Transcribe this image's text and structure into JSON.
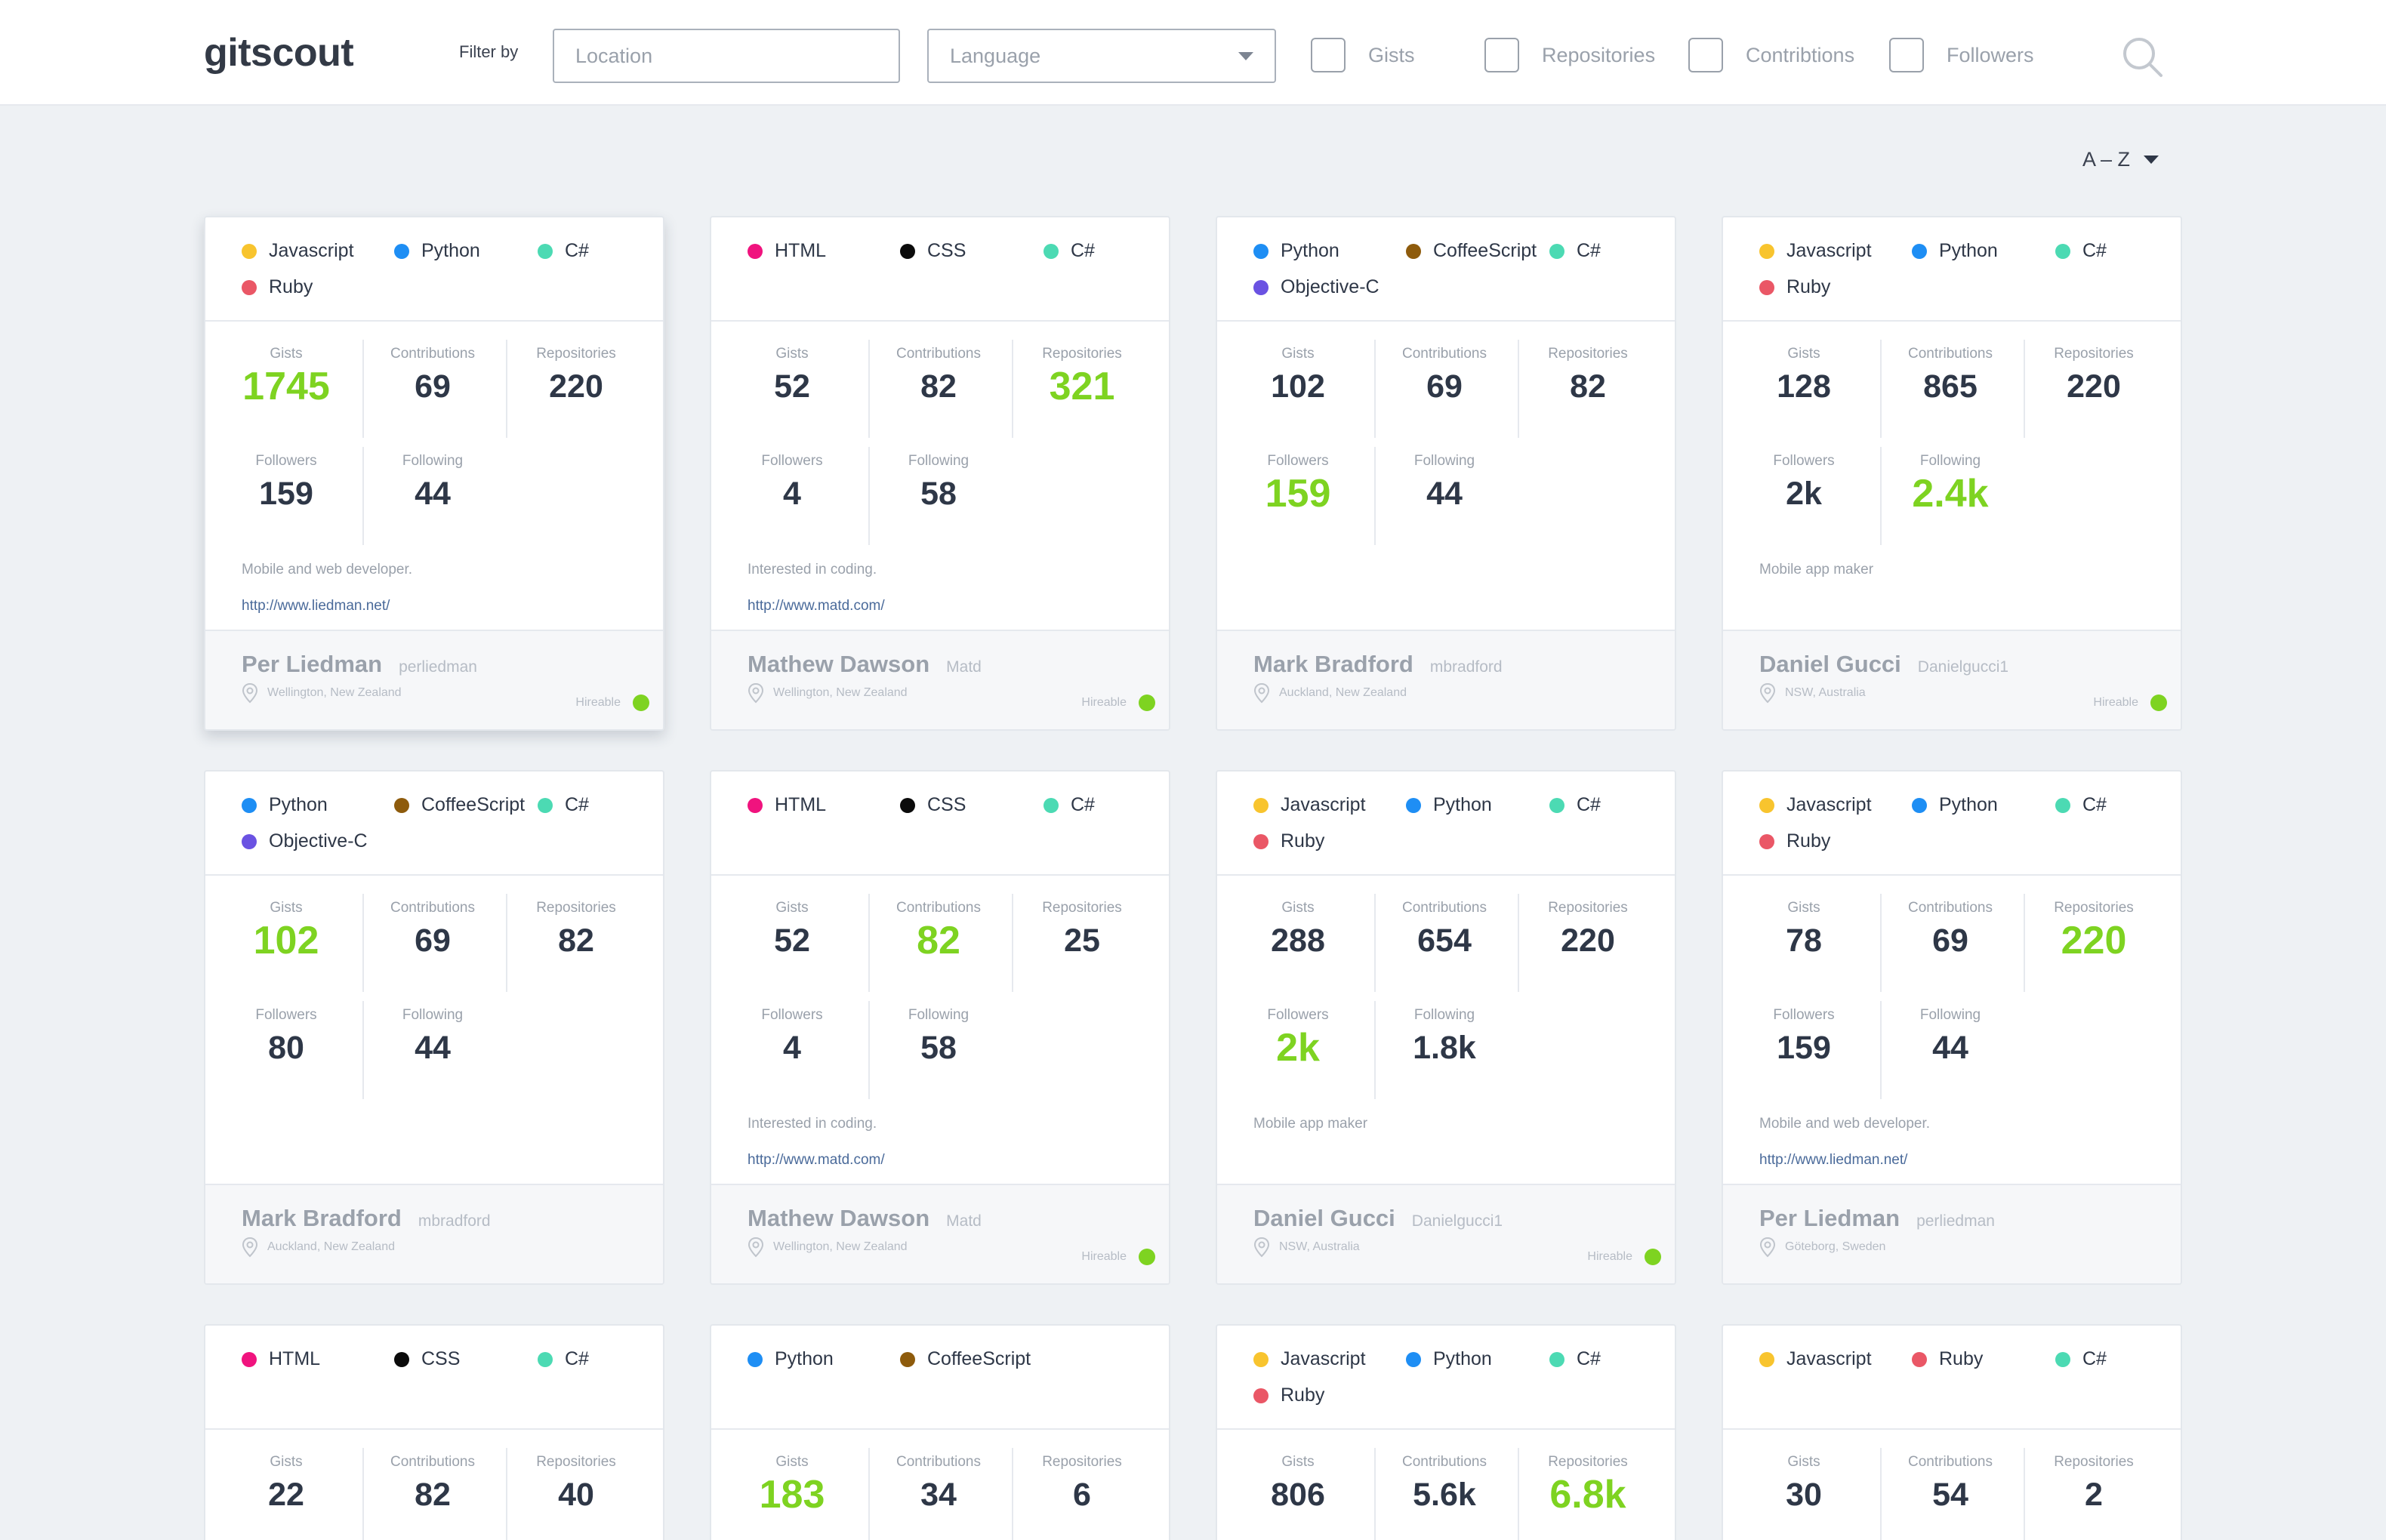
{
  "app": {
    "logo": "gitscout"
  },
  "filters": {
    "label": "Filter by",
    "location_placeholder": "Location",
    "language_placeholder": "Language",
    "checks": [
      "Gists",
      "Repositories",
      "Contribtions",
      "Followers"
    ]
  },
  "sort": {
    "label": "A – Z"
  },
  "colors": {
    "Javascript": "#f8c42e",
    "Python": "#1e8ef4",
    "C#": "#4cdab3",
    "Ruby": "#ea5766",
    "HTML": "#f0137e",
    "CSS": "#0b0b0b",
    "CoffeeScript": "#8e5b0c",
    "Objective-C": "#6a52e2",
    "highlight": "#7ed321"
  },
  "stat_labels": {
    "gists": "Gists",
    "contributions": "Contributions",
    "repositories": "Repositories",
    "followers": "Followers",
    "following": "Following"
  },
  "hireable_label": "Hireable",
  "cards": [
    {
      "langs": [
        "Javascript",
        "Python",
        "C#",
        "Ruby"
      ],
      "gists": "1745",
      "contributions": "69",
      "repositories": "220",
      "followers": "159",
      "following": "44",
      "highlight": "gists",
      "bio": "Mobile and web developer.",
      "url": "http://www.liedman.net/",
      "name": "Per Liedman",
      "username": "perliedman",
      "location": "Wellington, New Zealand",
      "hireable": true
    },
    {
      "langs": [
        "HTML",
        "CSS",
        "C#"
      ],
      "gists": "52",
      "contributions": "82",
      "repositories": "321",
      "followers": "4",
      "following": "58",
      "highlight": "repositories",
      "bio": "Interested in coding.",
      "url": "http://www.matd.com/",
      "name": "Mathew Dawson",
      "username": "Matd",
      "location": "Wellington, New Zealand",
      "hireable": true
    },
    {
      "langs": [
        "Python",
        "CoffeeScript",
        "C#",
        "Objective-C"
      ],
      "gists": "102",
      "contributions": "69",
      "repositories": "82",
      "followers": "159",
      "following": "44",
      "highlight": "followers",
      "bio": "",
      "url": "",
      "name": "Mark Bradford",
      "username": "mbradford",
      "location": "Auckland, New Zealand",
      "hireable": false
    },
    {
      "langs": [
        "Javascript",
        "Python",
        "C#",
        "Ruby"
      ],
      "gists": "128",
      "contributions": "865",
      "repositories": "220",
      "followers": "2k",
      "following": "2.4k",
      "highlight": "following",
      "bio": "Mobile app maker",
      "url": "",
      "name": "Daniel Gucci",
      "username": "Danielgucci1",
      "location": "NSW, Australia",
      "hireable": true
    },
    {
      "langs": [
        "Python",
        "CoffeeScript",
        "C#",
        "Objective-C"
      ],
      "gists": "102",
      "contributions": "69",
      "repositories": "82",
      "followers": "80",
      "following": "44",
      "highlight": "gists",
      "bio": "",
      "url": "",
      "name": "Mark Bradford",
      "username": "mbradford",
      "location": "Auckland, New Zealand",
      "hireable": false
    },
    {
      "langs": [
        "HTML",
        "CSS",
        "C#"
      ],
      "gists": "52",
      "contributions": "82",
      "repositories": "25",
      "followers": "4",
      "following": "58",
      "highlight": "contributions",
      "bio": "Interested in coding.",
      "url": "http://www.matd.com/",
      "name": "Mathew Dawson",
      "username": "Matd",
      "location": "Wellington, New Zealand",
      "hireable": true
    },
    {
      "langs": [
        "Javascript",
        "Python",
        "C#",
        "Ruby"
      ],
      "gists": "288",
      "contributions": "654",
      "repositories": "220",
      "followers": "2k",
      "following": "1.8k",
      "highlight": "followers",
      "bio": "Mobile app maker",
      "url": "",
      "name": "Daniel Gucci",
      "username": "Danielgucci1",
      "location": "NSW, Australia",
      "hireable": true
    },
    {
      "langs": [
        "Javascript",
        "Python",
        "C#",
        "Ruby"
      ],
      "gists": "78",
      "contributions": "69",
      "repositories": "220",
      "followers": "159",
      "following": "44",
      "highlight": "repositories",
      "bio": "Mobile and web developer.",
      "url": "http://www.liedman.net/",
      "name": "Per Liedman",
      "username": "perliedman",
      "location": "Göteborg, Sweden",
      "hireable": false
    },
    {
      "langs": [
        "HTML",
        "CSS",
        "C#"
      ],
      "gists": "22",
      "contributions": "82",
      "repositories": "40",
      "highlight": ""
    },
    {
      "langs": [
        "Python",
        "CoffeeScript"
      ],
      "gists": "183",
      "contributions": "34",
      "repositories": "6",
      "highlight": "gists"
    },
    {
      "langs": [
        "Javascript",
        "Python",
        "C#",
        "Ruby"
      ],
      "gists": "806",
      "contributions": "5.6k",
      "repositories": "6.8k",
      "highlight": "repositories"
    },
    {
      "langs": [
        "Javascript",
        "Ruby",
        "C#"
      ],
      "gists": "30",
      "contributions": "54",
      "repositories": "2",
      "highlight": ""
    }
  ]
}
